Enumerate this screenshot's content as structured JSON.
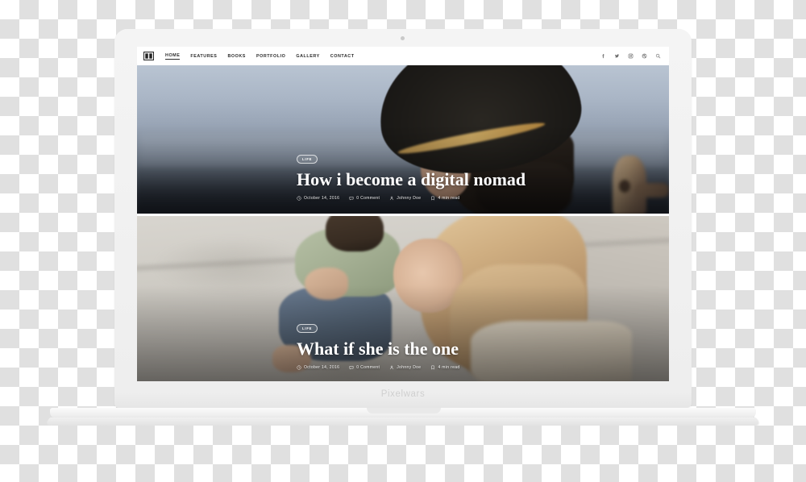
{
  "device": {
    "brand_label": "Pixelwars",
    "webcam": "webcam-dot"
  },
  "site": {
    "logo_icon": "open-book-icon",
    "nav": [
      {
        "label": "HOME",
        "active": true
      },
      {
        "label": "FEATURES",
        "active": false
      },
      {
        "label": "BOOKS",
        "active": false
      },
      {
        "label": "PORTFOLIO",
        "active": false
      },
      {
        "label": "GALLERY",
        "active": false
      },
      {
        "label": "CONTACT",
        "active": false
      }
    ],
    "social": [
      {
        "name": "facebook-icon"
      },
      {
        "name": "twitter-icon"
      },
      {
        "name": "instagram-icon"
      },
      {
        "name": "dribbble-icon"
      },
      {
        "name": "search-icon"
      }
    ]
  },
  "posts": [
    {
      "category": "LIFE",
      "title": "How i become a digital nomad",
      "date": "October 14, 2016",
      "comments": "0 Comment",
      "author": "Johnny Doe",
      "read_time": "4 min read"
    },
    {
      "category": "LIFE",
      "title": "What if she is the one",
      "date": "October 14, 2016",
      "comments": "0 Comment",
      "author": "Johnny Doe",
      "read_time": "4 min read"
    }
  ],
  "colors": {
    "nav_text": "#2b2b2b",
    "hero_text": "#ffffff",
    "device_body": "#f2f2f2",
    "brand_text": "#cfcfcf"
  }
}
